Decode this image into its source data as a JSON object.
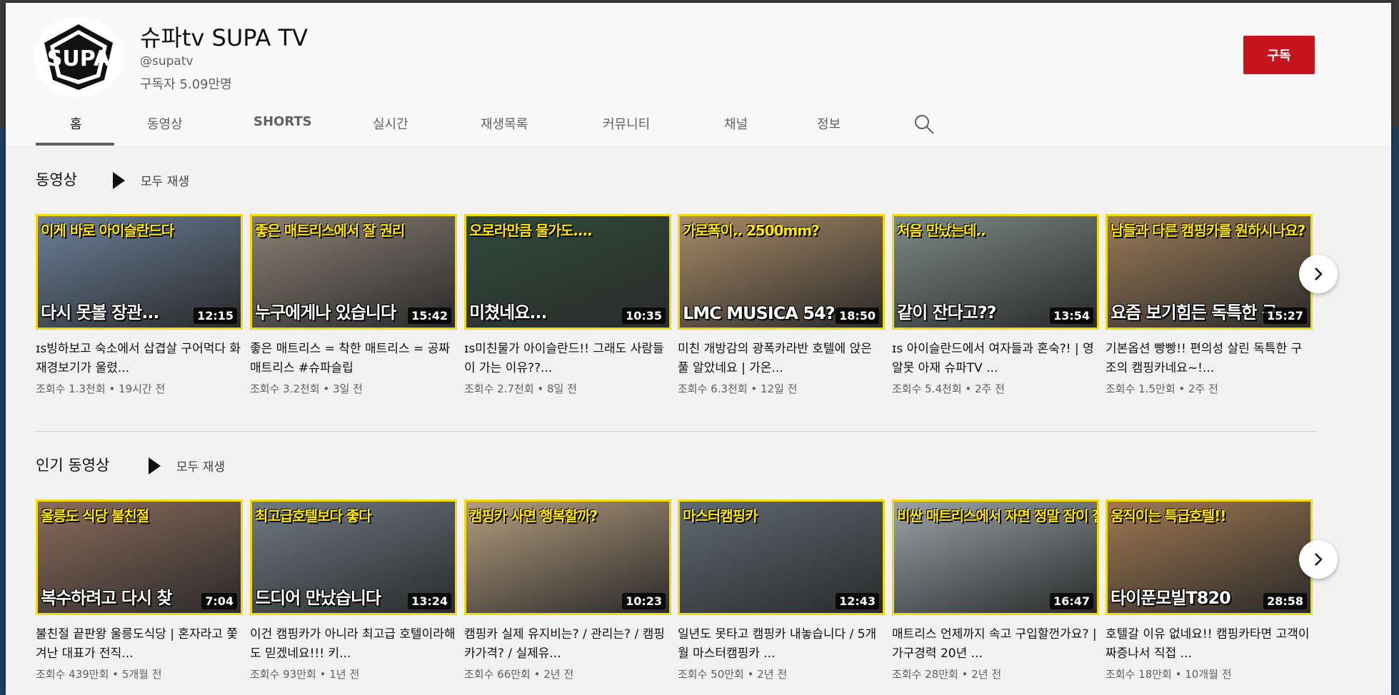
{
  "channel": {
    "name": "슈파tv SUPA TV",
    "handle": "@supatv",
    "subscribers": "구독자 5.09만명",
    "subscribe_label": "구독",
    "avatar_text": "SUPA"
  },
  "tabs": [
    "홈",
    "동영상",
    "SHORTS",
    "실시간",
    "재생목록",
    "커뮤니티",
    "채널",
    "정보"
  ],
  "sections": [
    {
      "title": "동영상",
      "play_all": "모두 재생",
      "videos": [
        {
          "top": "이게 바로 아이슬란드다",
          "caption": "다시 못볼 장관...",
          "duration": "12:15",
          "title": "ɪs빙하보고 숙소에서 삽겹살 구어먹다 화재경보기가 울렸...",
          "meta": "조회수 1.3천회 • 19시간 전",
          "color": "#6b7f99"
        },
        {
          "top": "좋은 매트리스에서 잘 권리",
          "caption": "누구에게나 있습니다",
          "duration": "15:42",
          "title": "좋은 매트리스 = 착한 매트리스 = 공짜 매트리스 #슈파슬립",
          "meta": "조회수 3.2천회 • 3일 전",
          "color": "#8a8174"
        },
        {
          "top": "오로라만큼 물가도....",
          "caption": "미쳤네요...",
          "duration": "10:35",
          "title": "ɪs미친물가 아이슬란드!! 그래도 사람들이 가는 이유??...",
          "meta": "조회수 2.7천회 • 8일 전",
          "color": "#2f4a3c"
        },
        {
          "top": "가로폭이.. 2500mm?",
          "caption": "LMC MUSICA 54?",
          "duration": "18:50",
          "title": "미친 개방감의 광폭카라반 호텔에 앉은 풀 알았네요 | 가온...",
          "meta": "조회수 6.3천회 • 12일 전",
          "color": "#a88a66"
        },
        {
          "top": "처음 만났는데..",
          "caption": "같이 잔다고??",
          "duration": "13:54",
          "title": "ɪs 아이슬란드에서 여자들과 혼숙?! | 영알못 아재 슈파TV ...",
          "meta": "조회수 5.4천회 • 2주 전",
          "color": "#7c8a86"
        },
        {
          "top": "남들과 다른 캠핑카를 원하시나요?",
          "caption": "요즘 보기힘든 독특한 구",
          "duration": "15:27",
          "title": "기본옵션 빵빵!! 편의성 살린 독특한 구조의 캠핑카네요~!...",
          "meta": "조회수 1.5만회 • 2주 전",
          "color": "#9a7a56"
        }
      ]
    },
    {
      "title": "인기 동영상",
      "play_all": "모두 재생",
      "videos": [
        {
          "top": "울릉도 식당 불친절",
          "caption": "복수하려고 다시 찾",
          "duration": "7:04",
          "title": "불친절 끝판왕 울릉도식당 | 혼자라고 쫓겨난 대표가 전직...",
          "meta": "조회수 439만회 • 5개월 전",
          "color": "#8b6b5a"
        },
        {
          "top": "최고급호텔보다 좋다",
          "caption": "드디어 만났습니다",
          "duration": "13:24",
          "title": "이건 캠핑카가 아니라 최고급 호텔이라해도 믿겠네요!!! 키...",
          "meta": "조회수 93만회 • 1년 전",
          "color": "#6f7a82"
        },
        {
          "top": "캠핑카 사면 행복할까?",
          "caption": "",
          "duration": "10:23",
          "title": "캠핑카 실제 유지비는? / 관리는? / 캠핑카가격? / 실제유...",
          "meta": "조회수 66만회 • 2년 전",
          "color": "#b39c7d"
        },
        {
          "top": "마스터캠핑카",
          "caption": "",
          "duration": "12:43",
          "title": "일년도 못타고 캠핑카 내놓습니다 / 5개월 마스터캠핑카 ...",
          "meta": "조회수 50만회 • 2년 전",
          "color": "#5e6a70"
        },
        {
          "top": "비싼 매트리스에서 자면 정말 잠이 잘 올까?",
          "caption": "",
          "duration": "16:47",
          "title": "매트리스 언제까지 속고 구입할껀가요? | 가구경력 20년 ...",
          "meta": "조회수 28만회 • 2년 전",
          "color": "#9aa3a6"
        },
        {
          "top": "움직이는 특급호텔!!",
          "caption": "타이푼모빌T820",
          "duration": "28:58",
          "title": "호텔갈 이유 없네요!! 캠핑카타면 고객이 짜증나서 직접 ...",
          "meta": "조회수 18만회 • 10개월 전",
          "color": "#a07850"
        }
      ]
    }
  ]
}
